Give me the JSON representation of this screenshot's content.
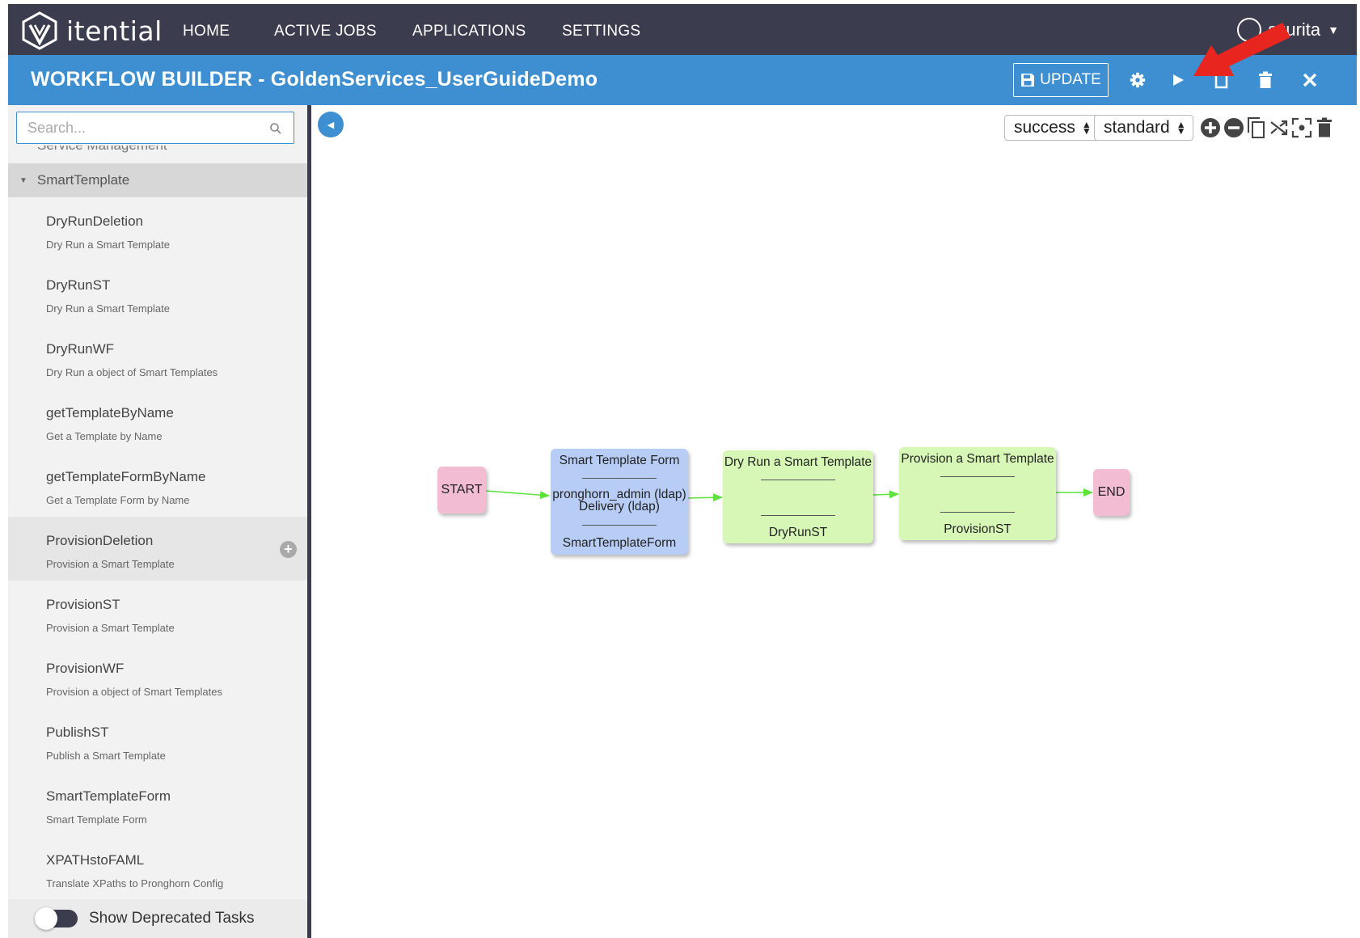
{
  "brand": {
    "name": "itential"
  },
  "nav": {
    "links": [
      "HOME",
      "ACTIVE JOBS",
      "APPLICATIONS",
      "SETTINGS"
    ],
    "user": "szurita"
  },
  "titlebar": {
    "title": "WORKFLOW BUILDER - GoldenServices_UserGuideDemo",
    "update_label": "UPDATE"
  },
  "sidebar": {
    "search_placeholder": "Search...",
    "previous_group": "Service Management",
    "group": "SmartTemplate",
    "tasks": [
      {
        "name": "DryRunDeletion",
        "desc": "Dry Run a Smart Template"
      },
      {
        "name": "DryRunST",
        "desc": "Dry Run a Smart Template"
      },
      {
        "name": "DryRunWF",
        "desc": "Dry Run a object of Smart Templates"
      },
      {
        "name": "getTemplateByName",
        "desc": "Get a Template by Name"
      },
      {
        "name": "getTemplateFormByName",
        "desc": "Get a Template Form by Name"
      },
      {
        "name": "ProvisionDeletion",
        "desc": "Provision a Smart Template"
      },
      {
        "name": "ProvisionST",
        "desc": "Provision a Smart Template"
      },
      {
        "name": "ProvisionWF",
        "desc": "Provision a object of Smart Templates"
      },
      {
        "name": "PublishST",
        "desc": "Publish a Smart Template"
      },
      {
        "name": "SmartTemplateForm",
        "desc": "Smart Template Form"
      },
      {
        "name": "XPATHstoFAML",
        "desc": "Translate XPaths to Pronghorn Config"
      }
    ],
    "deprecated_label": "Show Deprecated Tasks"
  },
  "canvas": {
    "transition_select": "success",
    "mode_select": "standard"
  },
  "workflow": {
    "start_label": "START",
    "end_label": "END",
    "nodes": [
      {
        "title": "Smart Template Form",
        "body_1": "pronghorn_admin (ldap)",
        "body_2": "Delivery (ldap)",
        "footer": "SmartTemplateForm"
      },
      {
        "title": "Dry Run a Smart Template",
        "footer": "DryRunST"
      },
      {
        "title": "Provision a Smart Template",
        "footer": "ProvisionST"
      }
    ]
  },
  "colors": {
    "nav_bg": "#3b3d4f",
    "accent": "#3d8fd1",
    "start_end_node": "#f2bcd3",
    "form_node": "#b7cdf6",
    "task_node": "#d7f7b6",
    "transition": "#5de33c",
    "annotation_arrow": "#e8251f"
  }
}
